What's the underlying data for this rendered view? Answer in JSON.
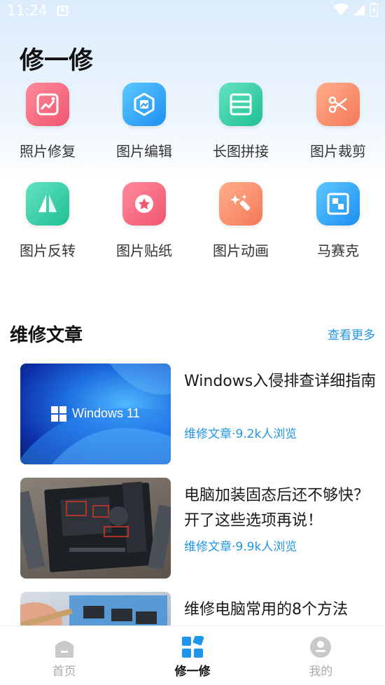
{
  "status_bar": {
    "time": "11:24",
    "a_icon": "A"
  },
  "page": {
    "title": "修一修"
  },
  "tools": [
    {
      "label": "照片修复",
      "icon": "photo-repair-icon",
      "color_from": "#ff8a9c",
      "color_to": "#f0566e"
    },
    {
      "label": "图片编辑",
      "icon": "image-edit-icon",
      "color_from": "#5cc8ff",
      "color_to": "#1d8ff0"
    },
    {
      "label": "长图拼接",
      "icon": "long-image-stitch-icon",
      "color_from": "#63e3c1",
      "color_to": "#1fbf94"
    },
    {
      "label": "图片裁剪",
      "icon": "image-crop-icon",
      "color_from": "#ffae8a",
      "color_to": "#f4785a"
    },
    {
      "label": "图片反转",
      "icon": "image-flip-icon",
      "color_from": "#63e3c1",
      "color_to": "#1fbf94"
    },
    {
      "label": "图片贴纸",
      "icon": "image-sticker-icon",
      "color_from": "#ff8a9c",
      "color_to": "#f0566e"
    },
    {
      "label": "图片动画",
      "icon": "image-animation-icon",
      "color_from": "#ffae8a",
      "color_to": "#f4785a"
    },
    {
      "label": "马赛克",
      "icon": "mosaic-icon",
      "color_from": "#5cc8ff",
      "color_to": "#1d8ff0"
    }
  ],
  "section": {
    "title": "维修文章",
    "more": "查看更多"
  },
  "articles": [
    {
      "title": "Windows入侵排查详细指南",
      "meta": "维修文章·9.2k人浏览",
      "thumb_text": "Windows 11"
    },
    {
      "title": "电脑加装固态后还不够快？开了这些选项再说！",
      "meta": "维修文章·9.9k人浏览"
    },
    {
      "title": "维修电脑常用的8个方法",
      "meta": ""
    }
  ],
  "bottom_nav": [
    {
      "label": "首页",
      "icon": "home-icon",
      "active": false
    },
    {
      "label": "修一修",
      "icon": "grid-icon",
      "active": true
    },
    {
      "label": "我的",
      "icon": "profile-icon",
      "active": false
    }
  ],
  "colors": {
    "accent": "#2196e6",
    "title": "#111111"
  }
}
